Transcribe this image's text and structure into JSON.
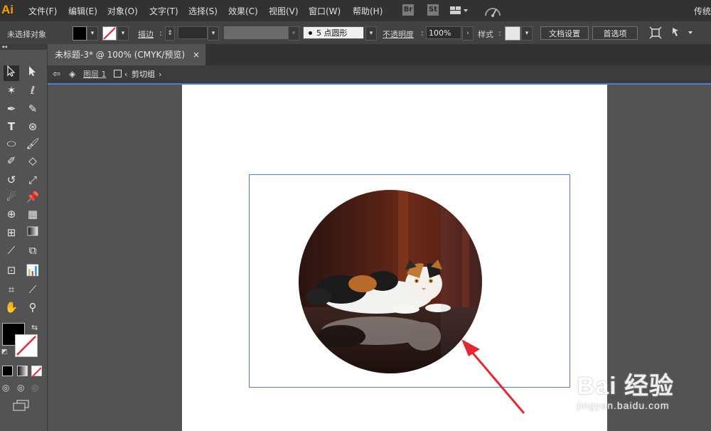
{
  "app": {
    "logo": "Ai"
  },
  "menubar": {
    "items": [
      "文件(F)",
      "编辑(E)",
      "对象(O)",
      "文字(T)",
      "选择(S)",
      "效果(C)",
      "视图(V)",
      "窗口(W)",
      "帮助(H)"
    ],
    "icons": [
      "Br",
      "St"
    ],
    "right_label": "传统"
  },
  "controlbar": {
    "selection_label": "未选择对象",
    "stroke_label": "描边",
    "brush_label": "5 点圆形",
    "opacity_label": "不透明度",
    "opacity_value": "100%",
    "style_label": "样式",
    "doc_setup_button": "文档设置",
    "preferences_button": "首选项"
  },
  "document": {
    "tab_title": "未标题-3* @ 100% (CMYK/预览)",
    "close_glyph": "×"
  },
  "breadcrumb": {
    "layer": "图层 1",
    "group": "剪切组"
  },
  "watermark": {
    "main": "Bai  经验",
    "sub": "jingyan.baidu.com"
  },
  "colors": {
    "menubar_bg": "#323232",
    "controlbar_bg": "#424242",
    "panel_bg": "#535353",
    "selection_blue": "#4a7ed8",
    "arrow_red": "#e8262d",
    "logo_orange": "#ff9a00"
  }
}
